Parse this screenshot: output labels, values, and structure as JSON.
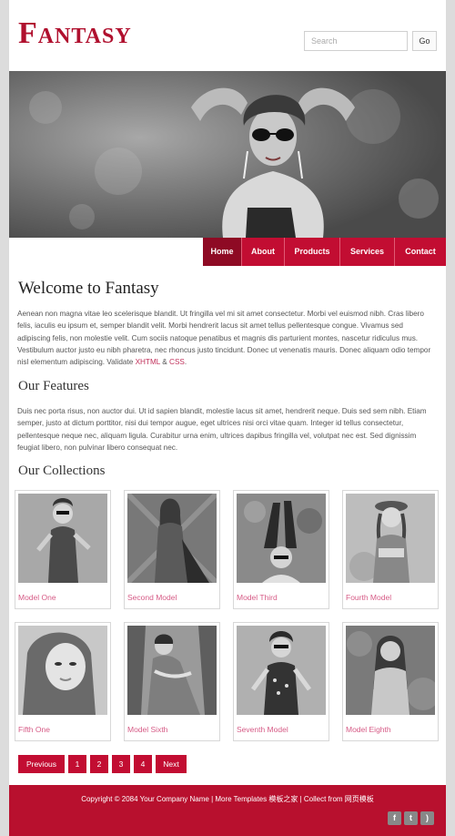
{
  "header": {
    "logo": "Fantasy",
    "search": {
      "placeholder": "Search",
      "go_label": "Go"
    }
  },
  "nav": {
    "items": [
      "Home",
      "About",
      "Products",
      "Services",
      "Contact"
    ],
    "active": "Home"
  },
  "welcome": {
    "title": "Welcome to Fantasy",
    "body_text": "Aenean non magna vitae leo scelerisque blandit. Ut fringilla vel mi sit amet consectetur. Morbi vel euismod nibh. Cras libero felis, iaculis eu ipsum et, semper blandit velit. Morbi hendrerit lacus sit amet tellus pellentesque congue. Vivamus sed adipiscing felis, non molestie velit. Cum sociis natoque penatibus et magnis dis parturient montes, nascetur ridiculus mus. Vestibulum auctor justo eu nibh pharetra, nec rhoncus justo tincidunt. Donec ut venenatis mauris. Donec aliquam odio tempor nisl elementum adipiscing. Validate",
    "link_xhtml": "XHTML",
    "amp": "&",
    "link_css": "CSS",
    "period": "."
  },
  "features": {
    "title": "Our Features",
    "body_text": "Duis nec porta risus, non auctor dui. Ut id sapien blandit, molestie lacus sit amet, hendrerit neque. Duis sed sem nibh. Etiam semper, justo at dictum porttitor, nisi dui tempor augue, eget ultrices nisi orci vitae quam. Integer id tellus consectetur, pellentesque neque nec, aliquam ligula. Curabitur urna enim, ultrices dapibus fringilla vel, volutpat nec est. Sed dignissim feugiat libero, non pulvinar libero consequat nec."
  },
  "collections": {
    "title": "Our Collections",
    "items": [
      "Model One",
      "Second Model",
      "Model Third",
      "Fourth Model",
      "Fifth One",
      "Model Sixth",
      "Seventh Model",
      "Model Eighth"
    ]
  },
  "pagination": {
    "previous": "Previous",
    "pages": [
      "1",
      "2",
      "3",
      "4"
    ],
    "next": "Next"
  },
  "footer": {
    "copyright": "Copyright © 2084 Your Company Name | More Templates 模板之家 | Collect from 网页模板",
    "social_icons": [
      "facebook-icon",
      "twitter-icon",
      "rss-icon"
    ]
  },
  "colors": {
    "accent": "#c20d32",
    "accent_dark": "#8e0a24",
    "caption": "#d65b86",
    "footer": "#b8102e"
  }
}
